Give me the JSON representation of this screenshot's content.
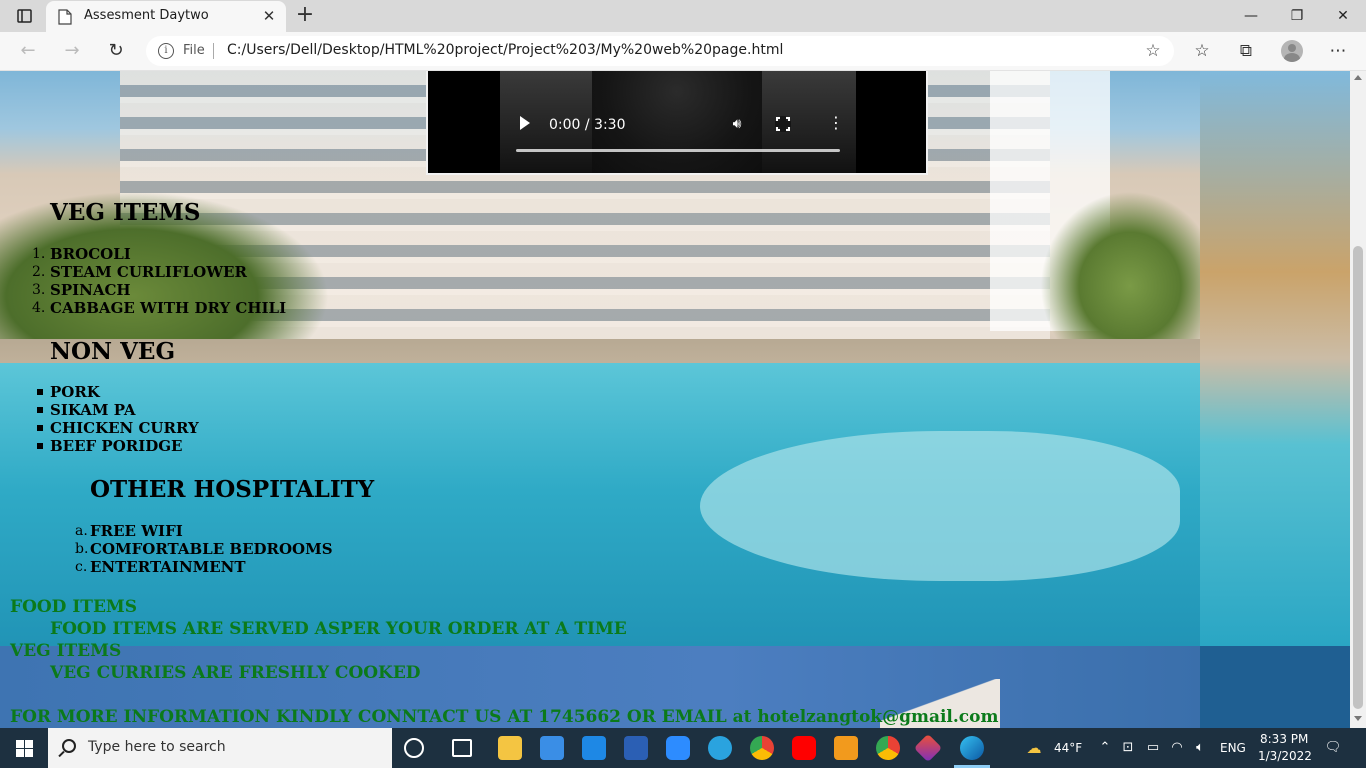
{
  "browser": {
    "tab_title": "Assesment Daytwo",
    "address_prefix": "File",
    "url": "C:/Users/Dell/Desktop/HTML%20project/Project%203/My%20web%20page.html"
  },
  "video": {
    "time": "0:00 / 3:30",
    "progress": 0
  },
  "veg": {
    "heading": "VEG ITEMS",
    "markers": [
      "1.",
      "2.",
      "3.",
      "4."
    ],
    "items": [
      "BROCOLI",
      "STEAM CURLIFLOWER",
      "SPINACH",
      "CABBAGE WITH DRY CHILI"
    ]
  },
  "nonveg": {
    "heading": "NON VEG",
    "items": [
      "PORK",
      "SIKAM PA",
      "CHICKEN CURRY",
      "BEEF PORIDGE"
    ]
  },
  "hospitality": {
    "heading": "OTHER HOSPITALITY",
    "markers": [
      "a.",
      "b.",
      "c."
    ],
    "items": [
      "FREE WIFI",
      "COMFORTABLE BEDROOMS",
      "ENTERTAINMENT"
    ]
  },
  "definitions": {
    "food_term": "FOOD ITEMS",
    "food_desc": "FOOD ITEMS ARE SERVED ASPER YOUR ORDER AT A TIME",
    "veg_term": "VEG ITEMS",
    "veg_desc": "VEG CURRIES ARE FRESHLY COOKED"
  },
  "contact": "FOR MORE INFORMATION KINDLY CONNTACT US AT 1745662 OR EMAIL at hotelzangtok@gmail.com",
  "taskbar": {
    "search_placeholder": "Type here to search",
    "weather": "44°F",
    "lang": "ENG",
    "time": "8:33 PM",
    "date": "1/3/2022"
  },
  "colors": {
    "heading_green": "#0b7a1a",
    "taskbar": "#1d3040"
  }
}
